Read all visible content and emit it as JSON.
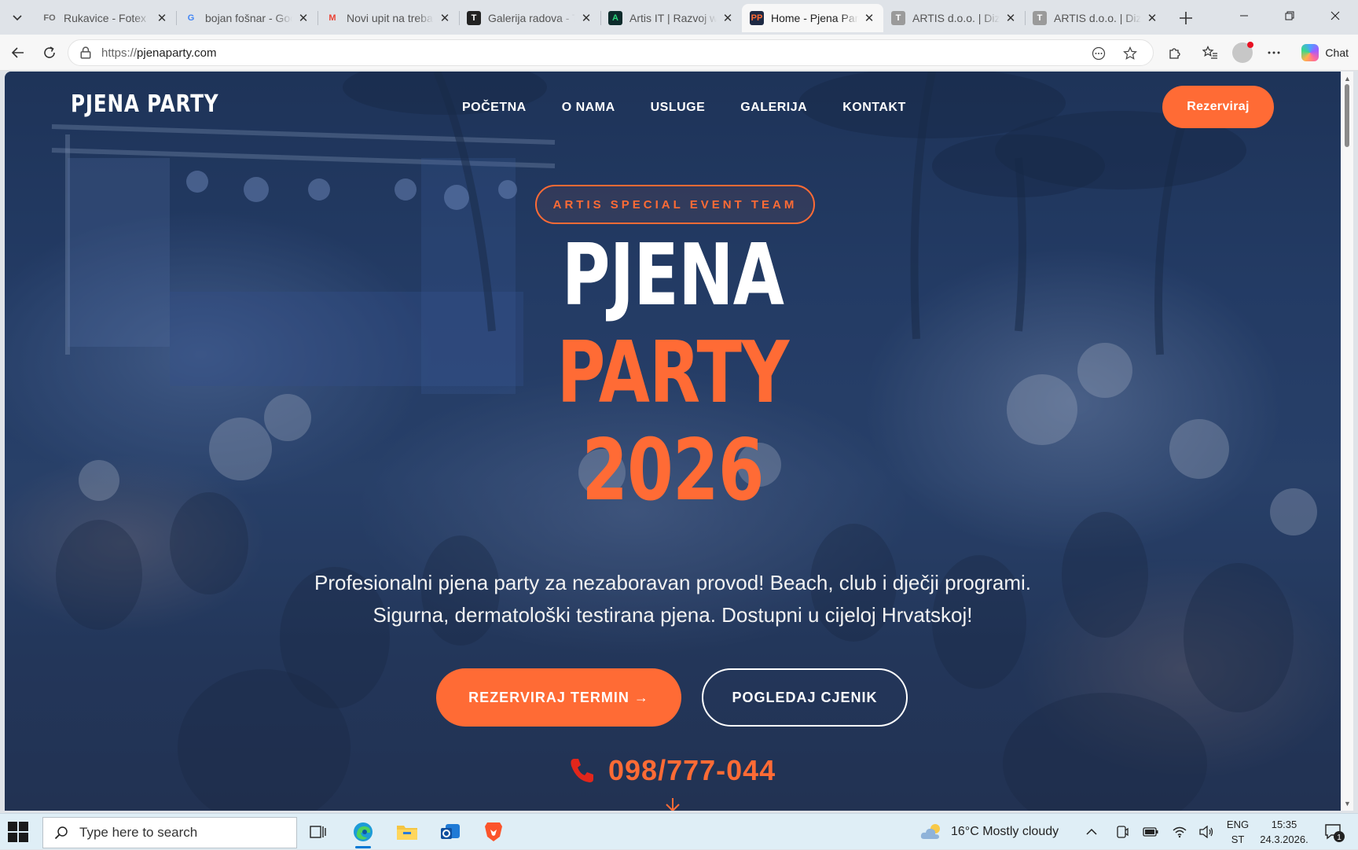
{
  "browser": {
    "tabs": [
      {
        "title": "Rukavice - Fotex",
        "favicon": "FO",
        "fav_color": "#6b6b6b",
        "fav_bg": "transparent"
      },
      {
        "title": "bojan fošnar - Goo",
        "favicon": "G",
        "fav_color": "#4285f4",
        "fav_bg": "transparent"
      },
      {
        "title": "Novi upit na treban",
        "favicon": "M",
        "fav_color": "#ea4335",
        "fav_bg": "transparent"
      },
      {
        "title": "Galerija radova - Tr",
        "favicon": "T",
        "fav_color": "#ffffff",
        "fav_bg": "#222222"
      },
      {
        "title": "Artis IT | Razvoj wel",
        "favicon": "A",
        "fav_color": "#2bd67b",
        "fav_bg": "#0d2b2b"
      },
      {
        "title": "Home - Pjena Party",
        "favicon": "PP",
        "fav_color": "#ff6b35",
        "fav_bg": "#1e2a44",
        "active": true
      },
      {
        "title": "ARTIS d.o.o. | Dizaj",
        "favicon": "T",
        "fav_color": "#ffffff",
        "fav_bg": "#9a9a9a"
      },
      {
        "title": "ARTIS d.o.o. | Dizaj",
        "favicon": "T",
        "fav_color": "#ffffff",
        "fav_bg": "#9a9a9a"
      }
    ],
    "url_protocol": "https://",
    "url_host": "pjenaparty.com",
    "chat_label": "Chat"
  },
  "site": {
    "logo": "PJENA PARTY",
    "nav": [
      "POČETNA",
      "O NAMA",
      "USLUGE",
      "GALERIJA",
      "KONTAKT"
    ],
    "cta_top": "Rezerviraj",
    "badge": "ARTIS SPECIAL EVENT TEAM",
    "hero_line1": "PJENA",
    "hero_line2": "PARTY",
    "hero_line3": "2026",
    "subtitle_line1": "Profesionalni pjena party za nezaboravan provod! Beach, club i dječji programi.",
    "subtitle_line2": "Sigurna, dermatološki testirana pjena. Dostupni u cijeloj Hrvatskoj!",
    "btn_primary": "REZERVIRAJ TERMIN →",
    "btn_outline": "POGLEDAJ CJENIK",
    "phone": "098/777-044",
    "accent_color": "#ff6b35"
  },
  "taskbar": {
    "search_placeholder": "Type here to search",
    "weather": "16°C  Mostly cloudy",
    "lang_line1": "ENG",
    "lang_line2": "ST",
    "time": "15:35",
    "date": "24.3.2026.",
    "notification_count": "1"
  }
}
